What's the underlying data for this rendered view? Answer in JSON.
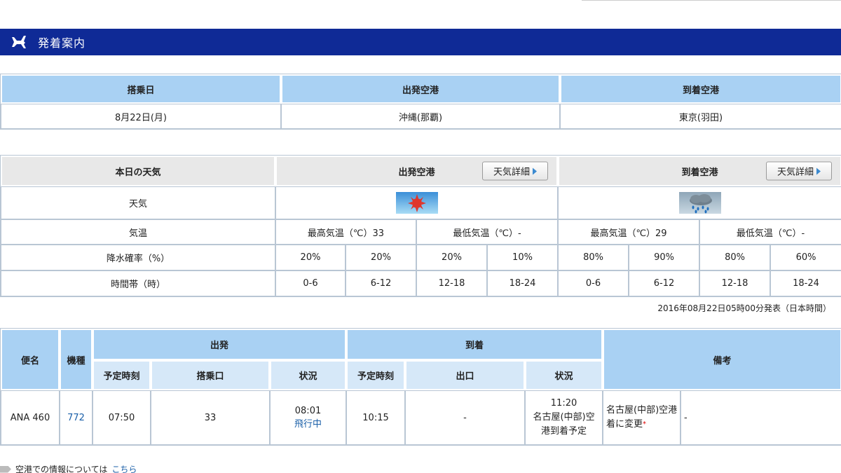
{
  "header": {
    "title": "発着案内",
    "icon": "airplane-icon"
  },
  "flight_info": {
    "headers": [
      "搭乗日",
      "出発空港",
      "到着空港"
    ],
    "values": [
      "8月22日(月)",
      "沖縄(那覇)",
      "東京(羽田)"
    ]
  },
  "weather": {
    "title": "本日の天気",
    "departure_label": "出発空港",
    "arrival_label": "到着空港",
    "detail_button": "天気詳細",
    "weather_label": "天気",
    "departure_icon": "sunny-icon",
    "arrival_icon": "rain-icon",
    "temp_label": "気温",
    "dep_high": "最高気温（℃）33",
    "dep_low": "最低気温（℃）-",
    "arr_high": "最高気温（℃）29",
    "arr_low": "最低気温（℃）-",
    "rain_label": "降水確率（%）",
    "dep_rain": [
      "20%",
      "20%",
      "20%",
      "10%"
    ],
    "arr_rain": [
      "80%",
      "90%",
      "80%",
      "60%"
    ],
    "time_label": "時間帯（時）",
    "time_slots": [
      "0-6",
      "6-12",
      "12-18",
      "18-24"
    ]
  },
  "announcement": "2016年08月22日05時00分発表（日本時間）",
  "flights": {
    "headers": {
      "flight": "便名",
      "aircraft": "機種",
      "departure": "出発",
      "arrival": "到着",
      "remarks": "備考",
      "dep_time": "予定時刻",
      "dep_gate": "搭乗口",
      "dep_status": "状況",
      "arr_time": "予定時刻",
      "arr_exit": "出口",
      "arr_status": "状況"
    },
    "row": {
      "flight": "ANA 460",
      "aircraft": "772",
      "dep_time": "07:50",
      "dep_gate": "33",
      "dep_status_time": "08:01",
      "dep_status_text": "飛行中",
      "arr_time": "10:15",
      "arr_exit": "-",
      "arr_status_time": "11:20",
      "arr_status_text": "名古屋(中部)空港到着予定",
      "remark1": "名古屋(中部)空港着に変更",
      "remark1_mark": "*",
      "remark2": "-"
    }
  },
  "footer": {
    "text": "空港での情報については",
    "link": "こちら"
  }
}
